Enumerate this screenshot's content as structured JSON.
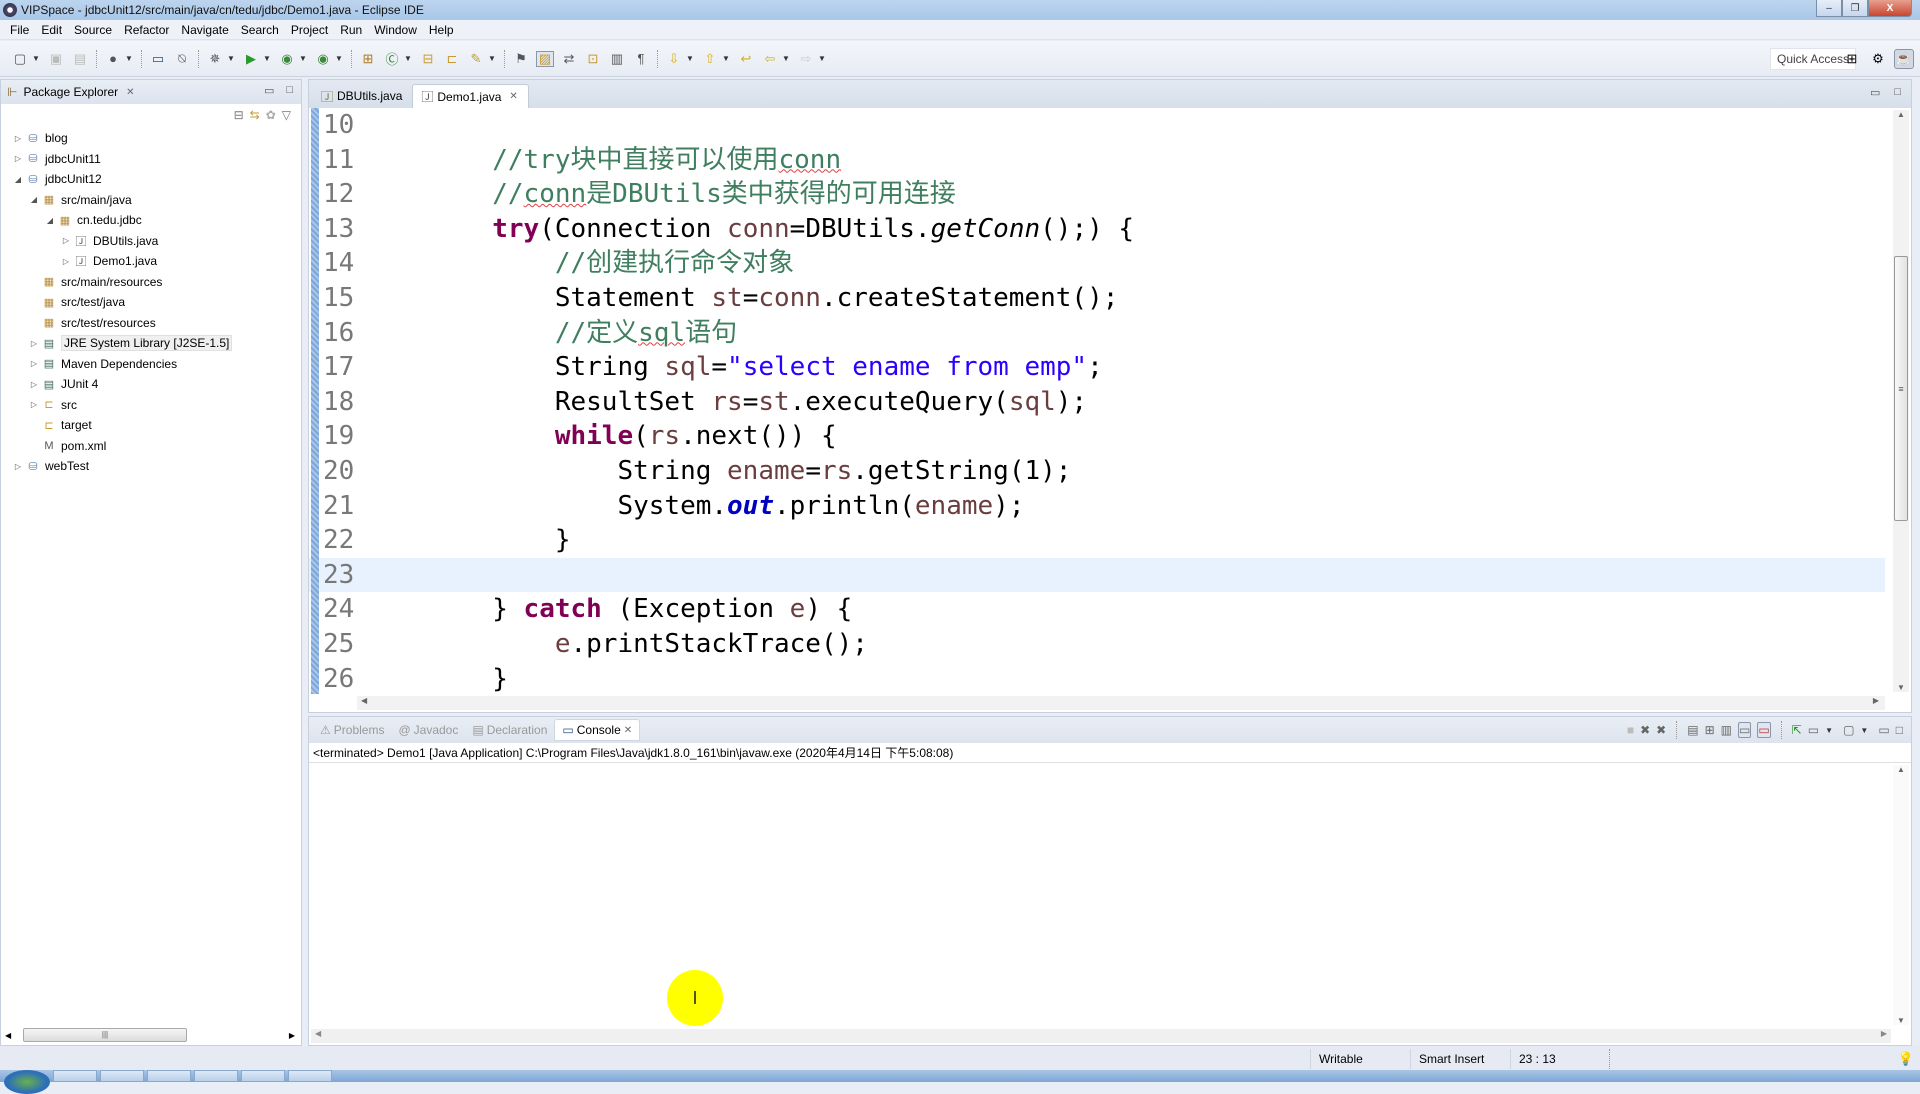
{
  "window": {
    "title": "VIPSpace - jdbcUnit12/src/main/java/cn/tedu/jdbc/Demo1.java - Eclipse IDE",
    "minimize": "‒",
    "restore": "❐",
    "close": "X"
  },
  "menu": [
    "File",
    "Edit",
    "Source",
    "Refactor",
    "Navigate",
    "Search",
    "Project",
    "Run",
    "Window",
    "Help"
  ],
  "toolbar": {
    "quick_access": "Quick Access"
  },
  "package_explorer": {
    "title": "Package Explorer",
    "tree": [
      {
        "label": "blog",
        "depth": 0,
        "arrow": "▷",
        "icon": "project-icon"
      },
      {
        "label": "jdbcUnit11",
        "depth": 0,
        "arrow": "▷",
        "icon": "maven-project-icon"
      },
      {
        "label": "jdbcUnit12",
        "depth": 0,
        "arrow": "◢",
        "icon": "maven-project-icon"
      },
      {
        "label": "src/main/java",
        "depth": 1,
        "arrow": "◢",
        "icon": "source-folder-icon"
      },
      {
        "label": "cn.tedu.jdbc",
        "depth": 2,
        "arrow": "◢",
        "icon": "package-icon"
      },
      {
        "label": "DBUtils.java",
        "depth": 3,
        "arrow": "▷",
        "icon": "java-file-icon"
      },
      {
        "label": "Demo1.java",
        "depth": 3,
        "arrow": "▷",
        "icon": "java-file-icon"
      },
      {
        "label": "src/main/resources",
        "depth": 1,
        "arrow": "",
        "icon": "source-folder-icon"
      },
      {
        "label": "src/test/java",
        "depth": 1,
        "arrow": "",
        "icon": "source-folder-icon"
      },
      {
        "label": "src/test/resources",
        "depth": 1,
        "arrow": "",
        "icon": "source-folder-icon"
      },
      {
        "label": "JRE System Library [J2SE-1.5]",
        "depth": 1,
        "arrow": "▷",
        "icon": "library-icon",
        "selected": true
      },
      {
        "label": "Maven Dependencies",
        "depth": 1,
        "arrow": "▷",
        "icon": "library-icon"
      },
      {
        "label": "JUnit 4",
        "depth": 1,
        "arrow": "▷",
        "icon": "library-icon"
      },
      {
        "label": "src",
        "depth": 1,
        "arrow": "▷",
        "icon": "folder-icon"
      },
      {
        "label": "target",
        "depth": 1,
        "arrow": "",
        "icon": "folder-icon"
      },
      {
        "label": "pom.xml",
        "depth": 1,
        "arrow": "",
        "icon": "xml-file-icon"
      },
      {
        "label": "webTest",
        "depth": 0,
        "arrow": "▷",
        "icon": "project-icon"
      }
    ]
  },
  "editor": {
    "tabs": [
      {
        "label": "DBUtils.java",
        "active": false
      },
      {
        "label": "Demo1.java",
        "active": true
      }
    ],
    "current_line": 23,
    "lines": [
      {
        "n": "10",
        "tokens": []
      },
      {
        "n": "11",
        "tokens": [
          {
            "t": "        //try块中直接可以使用",
            "c": "cm"
          },
          {
            "t": "conn",
            "c": "cm sq"
          }
        ]
      },
      {
        "n": "12",
        "tokens": [
          {
            "t": "        //",
            "c": "cm"
          },
          {
            "t": "conn",
            "c": "cm sq"
          },
          {
            "t": "是DBUtils类中获得的可用连接",
            "c": "cm"
          }
        ]
      },
      {
        "n": "13",
        "tokens": [
          {
            "t": "        ",
            "c": ""
          },
          {
            "t": "try",
            "c": "kw"
          },
          {
            "t": "(Connection ",
            "c": ""
          },
          {
            "t": "conn",
            "c": "var"
          },
          {
            "t": "=DBUtils.",
            "c": ""
          },
          {
            "t": "getConn",
            "c": "it"
          },
          {
            "t": "();) {",
            "c": ""
          }
        ]
      },
      {
        "n": "14",
        "tokens": [
          {
            "t": "            //创建执行命令对象",
            "c": "cm"
          }
        ]
      },
      {
        "n": "15",
        "tokens": [
          {
            "t": "            Statement ",
            "c": ""
          },
          {
            "t": "st",
            "c": "var"
          },
          {
            "t": "=",
            "c": ""
          },
          {
            "t": "conn",
            "c": "var"
          },
          {
            "t": ".createStatement();",
            "c": ""
          }
        ]
      },
      {
        "n": "16",
        "tokens": [
          {
            "t": "            //定义",
            "c": "cm"
          },
          {
            "t": "sql",
            "c": "cm sq"
          },
          {
            "t": "语句",
            "c": "cm"
          }
        ]
      },
      {
        "n": "17",
        "tokens": [
          {
            "t": "            String ",
            "c": ""
          },
          {
            "t": "sql",
            "c": "var"
          },
          {
            "t": "=",
            "c": ""
          },
          {
            "t": "\"select ename from emp\"",
            "c": "str"
          },
          {
            "t": ";",
            "c": ""
          }
        ]
      },
      {
        "n": "18",
        "tokens": [
          {
            "t": "            ResultSet ",
            "c": ""
          },
          {
            "t": "rs",
            "c": "var"
          },
          {
            "t": "=",
            "c": ""
          },
          {
            "t": "st",
            "c": "var"
          },
          {
            "t": ".executeQuery(",
            "c": ""
          },
          {
            "t": "sql",
            "c": "var"
          },
          {
            "t": ");",
            "c": ""
          }
        ]
      },
      {
        "n": "19",
        "tokens": [
          {
            "t": "            ",
            "c": ""
          },
          {
            "t": "while",
            "c": "kw"
          },
          {
            "t": "(",
            "c": ""
          },
          {
            "t": "rs",
            "c": "var"
          },
          {
            "t": ".next()) {",
            "c": ""
          }
        ]
      },
      {
        "n": "20",
        "tokens": [
          {
            "t": "                String ",
            "c": ""
          },
          {
            "t": "ename",
            "c": "var"
          },
          {
            "t": "=",
            "c": ""
          },
          {
            "t": "rs",
            "c": "var"
          },
          {
            "t": ".getString(1);",
            "c": ""
          }
        ]
      },
      {
        "n": "21",
        "tokens": [
          {
            "t": "                System.",
            "c": ""
          },
          {
            "t": "out",
            "c": "fld"
          },
          {
            "t": ".println(",
            "c": ""
          },
          {
            "t": "ename",
            "c": "var"
          },
          {
            "t": ");",
            "c": ""
          }
        ]
      },
      {
        "n": "22",
        "tokens": [
          {
            "t": "            }",
            "c": ""
          }
        ]
      },
      {
        "n": "23",
        "tokens": []
      },
      {
        "n": "24",
        "tokens": [
          {
            "t": "        } ",
            "c": ""
          },
          {
            "t": "catch",
            "c": "kw"
          },
          {
            "t": " (Exception ",
            "c": ""
          },
          {
            "t": "e",
            "c": "var"
          },
          {
            "t": ") {",
            "c": ""
          }
        ]
      },
      {
        "n": "25",
        "tokens": [
          {
            "t": "            ",
            "c": ""
          },
          {
            "t": "e",
            "c": "var"
          },
          {
            "t": ".printStackTrace();",
            "c": ""
          }
        ]
      },
      {
        "n": "26",
        "tokens": [
          {
            "t": "        }",
            "c": ""
          }
        ]
      }
    ]
  },
  "console": {
    "tabs": [
      {
        "label": "Problems",
        "active": false,
        "icon": "problems-icon"
      },
      {
        "label": "Javadoc",
        "active": false,
        "icon": "javadoc-icon"
      },
      {
        "label": "Declaration",
        "active": false,
        "icon": "declaration-icon"
      },
      {
        "label": "Console",
        "active": true,
        "icon": "console-icon"
      }
    ],
    "status": "<terminated> Demo1 [Java Application] C:\\Program Files\\Java\\jdk1.8.0_161\\bin\\javaw.exe (2020年4月14日 下午5:08:08)"
  },
  "statusbar": {
    "writable": "Writable",
    "insert_mode": "Smart Insert",
    "position": "23 : 13"
  },
  "colors": {
    "keyword": "#7f0055",
    "comment": "#3f7f5f",
    "string": "#2a00ff",
    "variable": "#6a3e3e",
    "field": "#0000c0",
    "current_line": "#e8f2fe",
    "cursor_highlight": "#ffff00"
  }
}
